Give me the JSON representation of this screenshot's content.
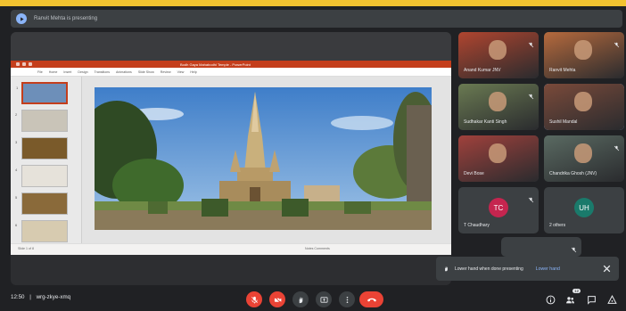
{
  "banner": {
    "text": "Ranvit Mehta is presenting",
    "icon": "present-icon"
  },
  "presentation": {
    "window_title": "Bodh Gaya Mahabodhi Temple - PowerPoint",
    "ribbon": [
      "File",
      "Home",
      "Insert",
      "Design",
      "Transitions",
      "Animations",
      "Slide Show",
      "Review",
      "View",
      "Help"
    ],
    "slide_count": 8,
    "current_slide": 1,
    "status_left": "Slide 1 of 8",
    "status_right": "Notes   Comments"
  },
  "participants": [
    {
      "name": "Anand Kumar JNV",
      "initials": "",
      "color": "#b0452f",
      "speaking": false,
      "muted": true
    },
    {
      "name": "Ranvit Mehta",
      "initials": "",
      "color": "#b66a3d",
      "speaking": false,
      "muted": true
    },
    {
      "name": "Sudhakar Kanti Singh",
      "initials": "",
      "color": "#6a7a52",
      "speaking": false,
      "muted": true
    },
    {
      "name": "Sushil Mandal",
      "initials": "",
      "color": "#7a4a3a",
      "speaking": true,
      "muted": false
    },
    {
      "name": "Devi Bose",
      "initials": "",
      "color": "#a0413c",
      "speaking": false,
      "muted": false
    },
    {
      "name": "Chandrika Ghosh (JNV)",
      "initials": "",
      "color": "#5a6a62",
      "speaking": false,
      "muted": true
    },
    {
      "name": "T Chaudhary",
      "initials": "TC",
      "color": "#c5254f",
      "speaking": false,
      "muted": true
    },
    {
      "name": "2 others",
      "initials": "UH",
      "color": "#1a7a6b",
      "speaking": false,
      "muted": false
    },
    {
      "name": "",
      "initials": "",
      "color": "#3c4043",
      "speaking": false,
      "muted": true
    }
  ],
  "toast": {
    "message": "Lower hand when done presenting",
    "link": "Lower hand"
  },
  "bottom": {
    "time": "12:50",
    "separator": "|",
    "meeting_code": "wrg-zkye-xmq",
    "participant_count": "12"
  },
  "colors": {
    "accent": "#8ab4f8",
    "danger": "#ea4335",
    "frame": "#f2c230"
  }
}
